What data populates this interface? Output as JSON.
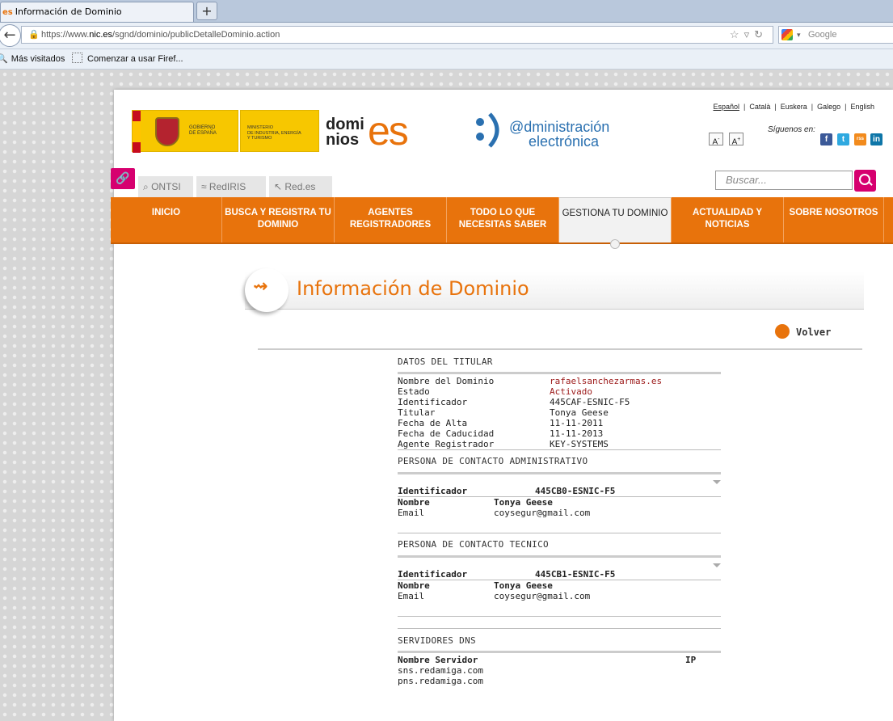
{
  "browser": {
    "tab_favicon": "es",
    "tab_title": "Información de Dominio",
    "new_tab": "+",
    "url_prefix": "https://www.",
    "url_domain": "nic.es",
    "url_path": "/sgnd/dominio/publicDetalleDominio.action",
    "search_placeholder": "Google",
    "bookmarks": [
      "Más visitados",
      "Comenzar a usar Firef..."
    ]
  },
  "header": {
    "gov_text": "GOBIERNO\nDE ESPAÑA",
    "ministry_text": "MINISTERIO\nDE INDUSTRIA, ENERGÍA\nY TURISMO",
    "dominios_text": "domi\nnios",
    "dominios_es": "es",
    "admin_line1": "@dministración",
    "admin_line2": "electrónica",
    "languages": [
      "Español",
      "Català",
      "Euskera",
      "Galego",
      "English"
    ],
    "font_small": "A",
    "font_large": "A",
    "siguenos": "Síguenos en:",
    "social": [
      "f",
      "t",
      "rss",
      "in"
    ]
  },
  "subnav": {
    "tabs": [
      "ONTSI",
      "RedIRIS",
      "Red.es"
    ],
    "search_placeholder": "Buscar..."
  },
  "menu": [
    {
      "label": "INICIO"
    },
    {
      "label": "BUSCA Y REGISTRA TU DOMINIO"
    },
    {
      "label": "AGENTES REGISTRADORES"
    },
    {
      "label": "TODO LO QUE NECESITAS SABER"
    },
    {
      "label": "GESTIONA TU DOMINIO"
    },
    {
      "label": "ACTUALIDAD Y NOTICIAS"
    },
    {
      "label": "SOBRE NOSOTROS"
    }
  ],
  "page": {
    "title": "Información de Dominio",
    "volver": "Volver"
  },
  "titular": {
    "section": "DATOS DEL TITULAR",
    "rows": [
      {
        "k": "Nombre del Dominio",
        "v": "rafaelsanchezarmas.es"
      },
      {
        "k": "Estado",
        "v": "Activado"
      },
      {
        "k": "Identificador",
        "v": "445CAF-ESNIC-F5"
      },
      {
        "k": "Titular",
        "v": "Tonya Geese"
      },
      {
        "k": "Fecha de Alta",
        "v": "11-11-2011"
      },
      {
        "k": "Fecha de Caducidad",
        "v": "11-11-2013"
      },
      {
        "k": "Agente Registrador",
        "v": "KEY-SYSTEMS"
      }
    ]
  },
  "admin": {
    "section": "PERSONA DE CONTACTO ADMINISTRATIVO",
    "id_label": "Identificador",
    "id_value": "445CB0-ESNIC-F5",
    "name_label": "Nombre",
    "name_value": "Tonya Geese",
    "email_label": "Email",
    "email_value": "coysegur@gmail.com"
  },
  "tecnico": {
    "section": "PERSONA DE CONTACTO TECNICO",
    "id_label": "Identificador",
    "id_value": "445CB1-ESNIC-F5",
    "name_label": "Nombre",
    "name_value": "Tonya Geese",
    "email_label": "Email",
    "email_value": "coysegur@gmail.com"
  },
  "dns": {
    "section": "SERVIDORES DNS",
    "col_name": "Nombre Servidor",
    "col_ip": "IP",
    "servers": [
      "sns.redamiga.com",
      "pns.redamiga.com"
    ]
  }
}
